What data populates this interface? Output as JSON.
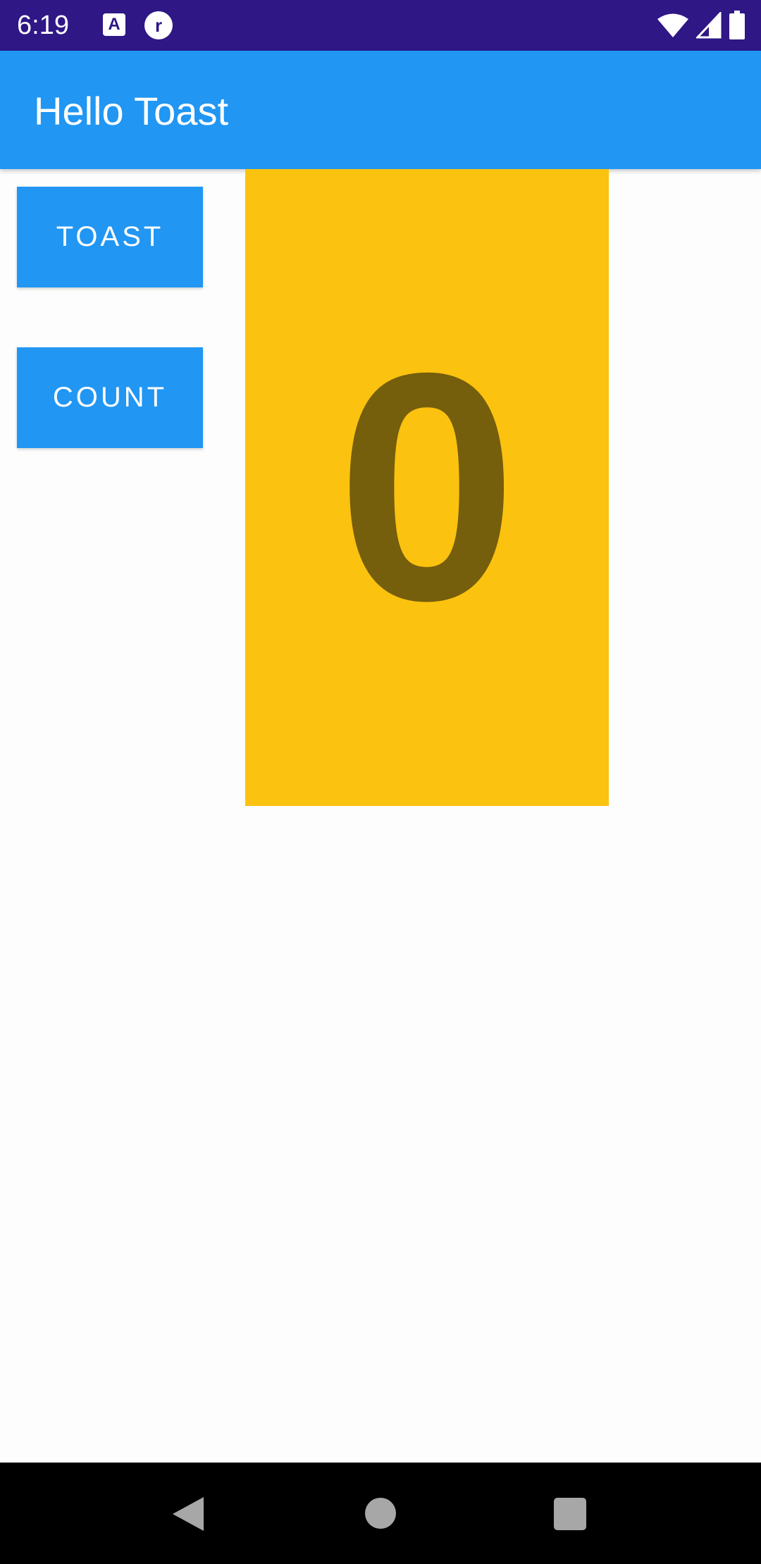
{
  "status_bar": {
    "time": "6:19",
    "notification_icons": [
      "accessibility-app-icon",
      "r-app-icon"
    ],
    "icon_a_label": "A",
    "icon_r_label": "r",
    "right_icons": [
      "wifi-icon",
      "cellular-signal-icon",
      "battery-icon"
    ],
    "background_color": "#2f1786"
  },
  "app_bar": {
    "title": "Hello Toast",
    "background_color": "#2196f3"
  },
  "buttons": {
    "toast_label": "TOAST",
    "count_label": "COUNT",
    "color": "#2196f3"
  },
  "counter": {
    "value": "0",
    "background_color": "#fbc20f",
    "text_color": "#755e0c"
  },
  "nav_bar": {
    "icons": [
      "back-icon",
      "home-icon",
      "recents-icon"
    ]
  }
}
